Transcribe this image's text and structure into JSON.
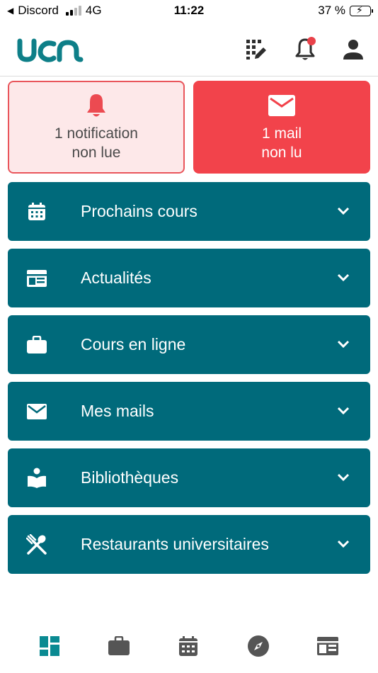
{
  "status_bar": {
    "back_app": "Discord",
    "network": "4G",
    "time": "11:22",
    "battery_text": "37 %",
    "battery_level": 0.37
  },
  "header": {
    "logo_text": "uca",
    "icons": [
      "grid-edit-icon",
      "bell-icon",
      "user-icon"
    ],
    "has_unread_notification": true
  },
  "summary": {
    "notifications": {
      "line1": "1 notification",
      "line2": "non lue"
    },
    "mails": {
      "line1": "1 mail",
      "line2": "non lu"
    }
  },
  "sections": [
    {
      "label": "Prochains cours",
      "icon": "calendar-icon"
    },
    {
      "label": "Actualités",
      "icon": "news-icon"
    },
    {
      "label": "Cours en ligne",
      "icon": "briefcase-icon"
    },
    {
      "label": "Mes mails",
      "icon": "mail-icon"
    },
    {
      "label": "Bibliothèques",
      "icon": "library-icon"
    },
    {
      "label": "Restaurants universitaires",
      "icon": "restaurant-icon"
    }
  ],
  "bottom_nav": {
    "items": [
      "dashboard-icon",
      "briefcase-icon",
      "calendar-icon",
      "compass-icon",
      "news-icon"
    ],
    "active_index": 0
  },
  "colors": {
    "primary": "#006a7b",
    "accent_red": "#f2434b",
    "notif_bg": "#fde8e9",
    "active_nav": "#0a8a92",
    "inactive_nav": "#555555"
  }
}
